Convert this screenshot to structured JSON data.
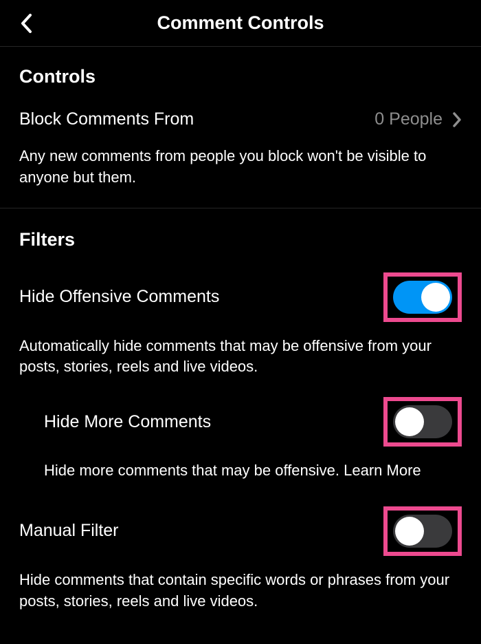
{
  "header": {
    "title": "Comment Controls"
  },
  "controls": {
    "section_title": "Controls",
    "block_comments": {
      "label": "Block Comments From",
      "value": "0 People",
      "description": "Any new comments from people you block won't be visible to anyone but them."
    }
  },
  "filters": {
    "section_title": "Filters",
    "hide_offensive": {
      "label": "Hide Offensive Comments",
      "enabled": true,
      "description": "Automatically hide comments that may be offensive from your posts, stories, reels and live videos."
    },
    "hide_more": {
      "label": "Hide More Comments",
      "enabled": false,
      "description": "Hide more comments that may be offensive. ",
      "learn_more": "Learn More"
    },
    "manual_filter": {
      "label": "Manual Filter",
      "enabled": false,
      "description": "Hide comments that contain specific words or phrases from your posts, stories, reels and live videos."
    }
  }
}
